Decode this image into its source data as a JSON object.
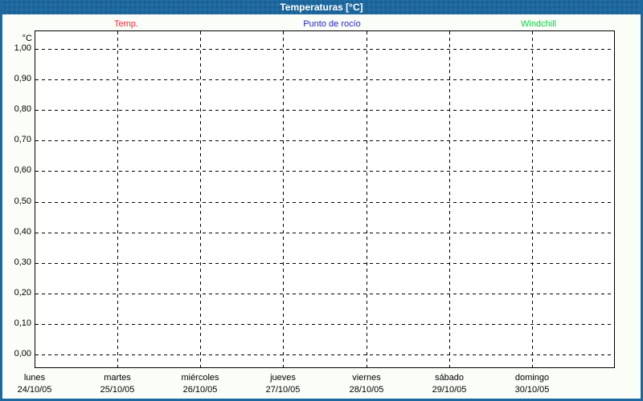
{
  "window": {
    "title": "Temperaturas [°C]"
  },
  "legend": {
    "items": [
      {
        "label": "Temp.",
        "color": "#ff2233"
      },
      {
        "label": "Punto de rocío",
        "color": "#2222cc"
      },
      {
        "label": "Windchill",
        "color": "#00d23c"
      }
    ]
  },
  "axes": {
    "unit": "°C"
  },
  "chart_data": {
    "type": "line",
    "title": "Temperaturas [°C]",
    "xlabel": "",
    "ylabel": "°C",
    "ylim": [
      0,
      1
    ],
    "y_ticks": [
      "1,00",
      "0,90",
      "0,80",
      "0,70",
      "0,60",
      "0,50",
      "0,40",
      "0,30",
      "0,20",
      "0,10",
      "0,00"
    ],
    "x_days": [
      {
        "name": "lunes",
        "date": "24/10/05"
      },
      {
        "name": "martes",
        "date": "25/10/05"
      },
      {
        "name": "miércoles",
        "date": "26/10/05"
      },
      {
        "name": "jueves",
        "date": "27/10/05"
      },
      {
        "name": "viernes",
        "date": "28/10/05"
      },
      {
        "name": "sábado",
        "date": "29/10/05"
      },
      {
        "name": "domingo",
        "date": "30/10/05"
      }
    ],
    "grid": "dashed",
    "legend_position": "top",
    "series": [
      {
        "name": "Temp.",
        "color": "#ff2233",
        "values": []
      },
      {
        "name": "Punto de rocío",
        "color": "#2222cc",
        "values": []
      },
      {
        "name": "Windchill",
        "color": "#00d23c",
        "values": []
      }
    ],
    "note": "empty plot area — no data lines rendered"
  },
  "colors": {
    "titlebar": "#1d689e",
    "border": "#1d689e",
    "plot_background": "#ffffff",
    "page_background": "#fbfef8",
    "grid": "#000000"
  }
}
